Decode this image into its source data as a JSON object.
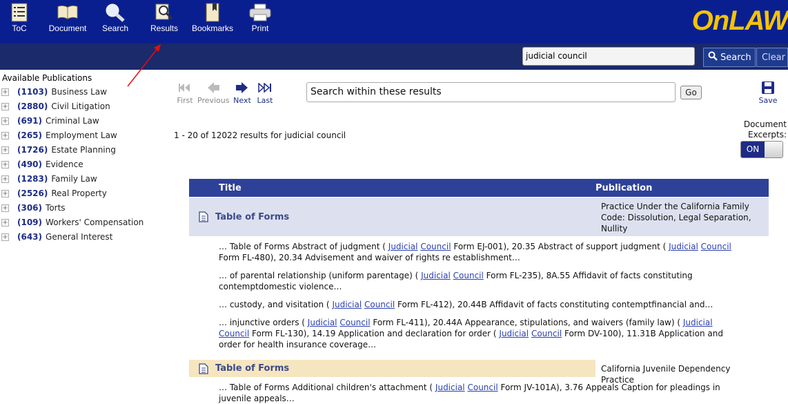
{
  "toolbar": {
    "toc": "ToC",
    "document": "Document",
    "search": "Search",
    "results": "Results",
    "bookmarks": "Bookmarks",
    "print": "Print"
  },
  "logo": "OnLAW",
  "search": {
    "value": "judicial council",
    "search_label": "Search",
    "clear_label": "Clear"
  },
  "sidebar": {
    "heading": "Available Publications",
    "items": [
      {
        "count": "(1103)",
        "label": "Business Law"
      },
      {
        "count": "(2880)",
        "label": "Civil Litigation"
      },
      {
        "count": "(691)",
        "label": "Criminal Law"
      },
      {
        "count": "(265)",
        "label": "Employment Law"
      },
      {
        "count": "(1726)",
        "label": "Estate Planning"
      },
      {
        "count": "(490)",
        "label": "Evidence"
      },
      {
        "count": "(1283)",
        "label": "Family Law"
      },
      {
        "count": "(2526)",
        "label": "Real Property"
      },
      {
        "count": "(306)",
        "label": "Torts"
      },
      {
        "count": "(109)",
        "label": "Workers' Compensation"
      },
      {
        "count": "(643)",
        "label": "General Interest"
      }
    ]
  },
  "pager": {
    "first": "First",
    "previous": "Previous",
    "next": "Next",
    "last": "Last"
  },
  "within": {
    "value": "Search within these results",
    "go": "Go"
  },
  "save_label": "Save",
  "results_count": "1 - 20 of 12022 results  for judicial council",
  "excerpts": {
    "label_1": "Document",
    "label_2": "Excerpts:",
    "toggle": "ON"
  },
  "table": {
    "col_title": "Title",
    "col_publication": "Publication",
    "rows": [
      {
        "title": "Table of Forms",
        "publication": "Practice Under the California Family Code: Dissolution, Legal Separation, Nullity"
      },
      {
        "title": "Table of Forms",
        "publication": "California Juvenile Dependency Practice"
      }
    ]
  },
  "link_words": {
    "judicial": "Judicial",
    "council": "Council"
  },
  "excerpt_text": {
    "e1a": "… Table of Forms Abstract of judgment ( ",
    "e1b": " Form EJ-001), 20.35 Abstract of support judgment ( ",
    "e1c": " Form FL-480), 20.34 Advisement and waiver of rights re establishment…",
    "e2a": "… of parental relationship (uniform parentage) ( ",
    "e2b": " Form FL-235), 8A.55 Affidavit of facts constituting contemptdomestic violence…",
    "e3a": "… custody, and visitation ( ",
    "e3b": " Form FL-412), 20.44B Affidavit of facts constituting contemptfinancial and…",
    "e4a": "… injunctive orders ( ",
    "e4b": " Form FL-411), 20.44A Appearance, stipulations, and waivers (family law) ( ",
    "e4c": " Form FL-130), 14.19 Application and declaration for order ( ",
    "e4d": " Form DV-100), 11.31B Application and order for health insurance coverage…",
    "e5a": "… Table of Forms Additional children's attachment ( ",
    "e5b": " Form JV-101A), 3.76 Appeals Caption for pleadings in juvenile appeals…"
  },
  "colors": {
    "topbar": "#0a1f8f",
    "subbar": "#1a2a6b",
    "logo": "#f5c400",
    "table_header": "#2e4198",
    "row_blue": "#dde1ef",
    "row_tan": "#f6e6c0"
  }
}
